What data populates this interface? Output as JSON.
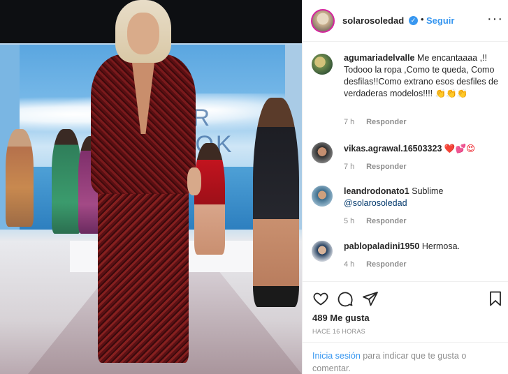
{
  "header": {
    "username": "solarosoledad",
    "separator": "•",
    "follow_label": "Seguir",
    "more_label": "···"
  },
  "photo": {
    "backdrop_text_line1": "AR",
    "backdrop_text_line2": "OOK"
  },
  "comments": [
    {
      "user": "agumariadelvalle",
      "text": "Me encantaaaa ,!! Todooo la ropa ,Como te queda, Como desfilas!!Como extrano esos desfiles de verdaderas modelos!!!!",
      "emoji": "👏👏👏",
      "time": "7 h",
      "reply": "Responder"
    },
    {
      "user": "vikas.agrawal.16503323",
      "text": "",
      "emoji": "❤️💕😍",
      "time": "7 h",
      "reply": "Responder"
    },
    {
      "user": "leandrodonato1",
      "text": "Sublime",
      "mention": "@solarosoledad",
      "time": "5 h",
      "reply": "Responder"
    },
    {
      "user": "pablopaladini1950",
      "text": "Hermosa.",
      "time": "4 h",
      "reply": "Responder"
    }
  ],
  "actions": {
    "likes": "489 Me gusta",
    "time_ago": "HACE 16 HORAS"
  },
  "login": {
    "link": "Inicia sesión",
    "text": " para indicar que te gusta o comentar."
  },
  "colors": {
    "accent": "#3897f0",
    "text": "#262626",
    "muted": "#8e8e8e"
  }
}
